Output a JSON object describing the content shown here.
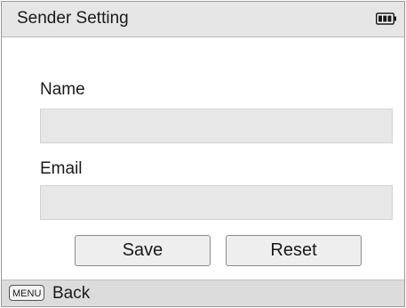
{
  "header": {
    "title": "Sender Setting",
    "battery_icon": "battery-full-icon"
  },
  "form": {
    "name_label": "Name",
    "name_value": "",
    "email_label": "Email",
    "email_value": ""
  },
  "buttons": {
    "save_label": "Save",
    "reset_label": "Reset"
  },
  "footer": {
    "menu_key_label": "MENU",
    "back_label": "Back"
  },
  "colors": {
    "titlebar_bg": "#e6e6e6",
    "field_bg": "#e7e7e7",
    "button_bg": "#eeeeee",
    "footer_bg": "#dcdcdc"
  }
}
